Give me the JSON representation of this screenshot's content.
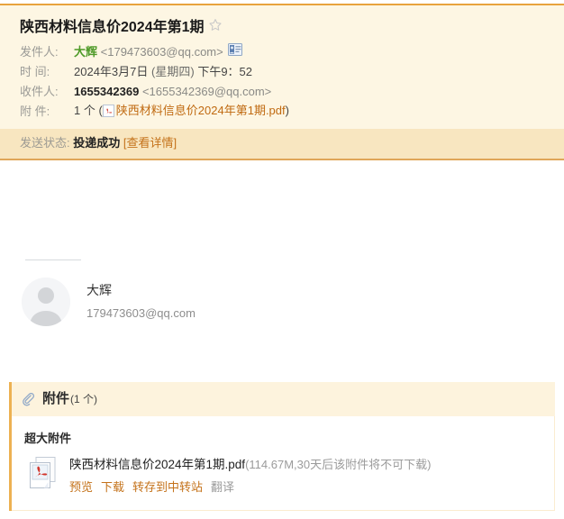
{
  "header": {
    "subject": "陕西材料信息价2024年第1期",
    "star_icon": "star-outline-icon",
    "fields": {
      "from_label": "发件人:",
      "from_name": "大辉",
      "from_address": "<179473603@qq.com>",
      "vcard_icon": "contact-card-icon",
      "date_label": "时 间:",
      "date_value": "2024年3月7日",
      "date_weekday": "(星期四)",
      "date_time": "下午9：52",
      "to_label": "收件人:",
      "to_name": "1655342369",
      "to_address": "<1655342369@qq.com>",
      "attach_label": "附 件:",
      "attach_count": "1 个 (",
      "attach_file_icon": "pdf-file-icon",
      "attach_file_name": "陕西材料信息价2024年第1期.pdf",
      "attach_close": ")"
    },
    "status": {
      "label": "发送状态:",
      "value": "投递成功",
      "detail_link": "[查看详情]"
    }
  },
  "body": {
    "signature": {
      "avatar_icon": "person-avatar-icon",
      "name": "大辉",
      "email": "179473603@qq.com"
    }
  },
  "attachments": {
    "clip_icon": "paperclip-icon",
    "panel_title": "附件",
    "panel_count": "(1 个)",
    "group_title": "超大附件",
    "items": [
      {
        "icon": "pdf-file-icon",
        "name": "陕西材料信息价2024年第1期.pdf",
        "meta": "(114.67M,30天后该附件将不可下载)",
        "actions": [
          {
            "label": "预览",
            "muted": false
          },
          {
            "label": "下载",
            "muted": false
          },
          {
            "label": "转存到中转站",
            "muted": false
          },
          {
            "label": "翻译",
            "muted": true
          }
        ]
      }
    ]
  },
  "colors": {
    "accent_orange": "#e8a33d",
    "link_orange": "#c4721a",
    "panel_cream": "#fdf6e3",
    "status_cream": "#f8e6c0",
    "sender_green": "#4e9a28"
  }
}
